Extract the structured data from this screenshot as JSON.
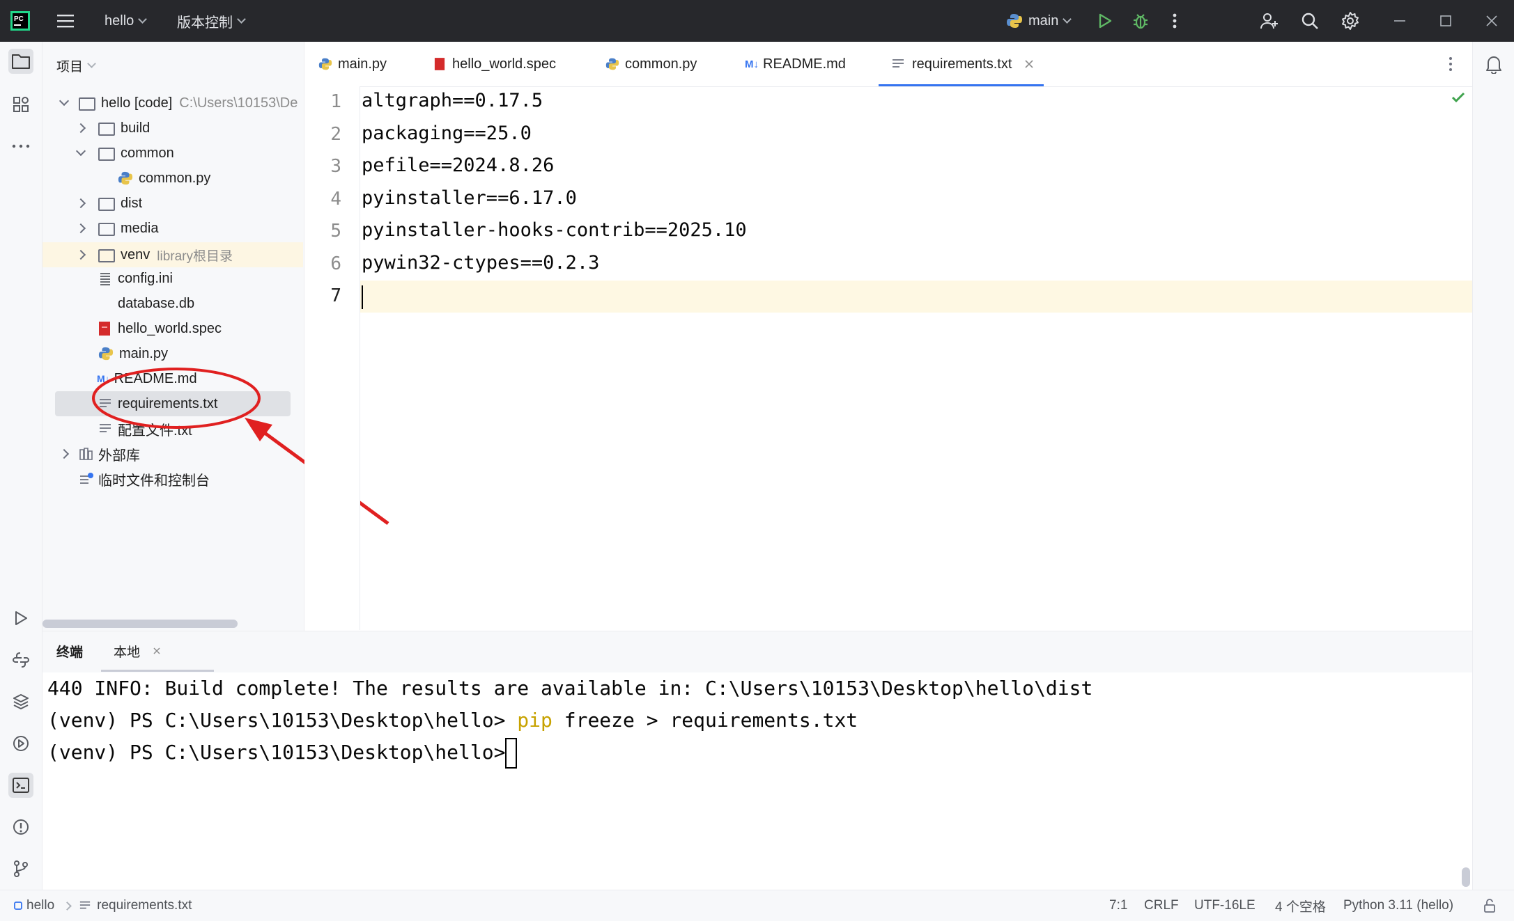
{
  "titlebar": {
    "project_name": "hello",
    "vcs_menu": "版本控制",
    "branch": "main"
  },
  "project_panel": {
    "title": "项目",
    "tree": [
      {
        "label": "hello [code]",
        "hint": "C:\\Users\\10153\\De"
      },
      {
        "label": "build"
      },
      {
        "label": "common"
      },
      {
        "label": "common.py"
      },
      {
        "label": "dist"
      },
      {
        "label": "media"
      },
      {
        "label": "venv",
        "hint": "library根目录"
      },
      {
        "label": "config.ini"
      },
      {
        "label": "database.db"
      },
      {
        "label": "hello_world.spec"
      },
      {
        "label": "main.py"
      },
      {
        "label": "README.md"
      },
      {
        "label": "requirements.txt"
      },
      {
        "label": "配置文件.txt"
      },
      {
        "label": "外部库"
      },
      {
        "label": "临时文件和控制台"
      }
    ]
  },
  "editor": {
    "tabs": [
      {
        "label": "main.py"
      },
      {
        "label": "hello_world.spec"
      },
      {
        "label": "common.py"
      },
      {
        "label": "README.md"
      },
      {
        "label": "requirements.txt"
      }
    ],
    "line_numbers": [
      "1",
      "2",
      "3",
      "4",
      "5",
      "6",
      "7"
    ],
    "lines": [
      "altgraph==0.17.5",
      "packaging==25.0",
      "pefile==2024.8.26",
      "pyinstaller==6.17.0",
      "pyinstaller-hooks-contrib==2025.10",
      "pywin32-ctypes==0.2.3",
      ""
    ]
  },
  "terminal": {
    "title": "终端",
    "tab": "本地",
    "line1": "440 INFO: Build complete! The results are available in: C:\\Users\\10153\\Desktop\\hello\\dist",
    "prompt": "(venv) PS C:\\Users\\10153\\Desktop\\hello> ",
    "cmd_pip": "pip",
    "cmd_rest": " freeze > requirements.txt"
  },
  "statusbar": {
    "project": "hello",
    "file": "requirements.txt",
    "position": "7:1",
    "line_sep": "CRLF",
    "encoding": "UTF-16LE",
    "indent": "4 个空格",
    "interpreter": "Python 3.11 (hello)"
  },
  "colors": {
    "accent": "#3574f0",
    "annotation_red": "#e02020",
    "pip_keyword": "#c7a200"
  }
}
